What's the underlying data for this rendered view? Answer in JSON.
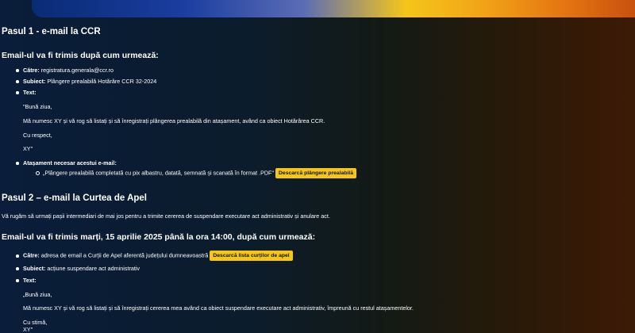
{
  "step1": {
    "title": "Pasul 1 - e-mail la CCR",
    "subtitle": "Email-ul va fi trimis după cum urmează:",
    "to_label": "Către:",
    "to_value": "registratura.generala@ccr.ro",
    "subject_label": "Subiect:",
    "subject_value": "Plângere prealabilă Hotărâre CCR 32-2024",
    "text_label": "Text:",
    "text_lines": [
      "\"Bună ziua,",
      "Mă numesc XY și vă rog să listați și să înregistrați plângerea prealabilă din atașament, având ca obiect Hotărârea CCR.",
      "Cu respect,",
      "XY\""
    ],
    "attachment_label": "Atașament necesar acestui e-mail:",
    "attachment_item": "„Plângere prealabilă completată cu pix albastru, datată, semnată și scanată în format .PDF\"",
    "download_button": "Descarcă plângere prealabilă"
  },
  "step2": {
    "title": "Pasul 2 – e-mail la Curtea de Apel",
    "intro": "Vă rugăm să urmați pașii intermediari de mai jos pentru a trimite cererea de suspendare executare act administrativ și anulare act.",
    "subtitle": "Email-ul va fi trimis marți, 15 aprilie 2025 până la ora 14:00, după cum urmează:",
    "to_label": "Către:",
    "to_value": "adresa de email a Curții de Apel aferentă județului dumneavoastră",
    "download_button": "Descarcă lista curților de apel",
    "subject_label": "Subiect:",
    "subject_value": "acțiune suspendare act administrativ",
    "text_label": "Text:",
    "text_lines": [
      "„Bună ziua,",
      "Mă numesc XY și vă rog să listați și să înregistrați cererea mea având ca obiect suspendare executare act administrativ, împreună cu restul atașamentelor.",
      "Cu stimă,",
      "XY\""
    ]
  }
}
